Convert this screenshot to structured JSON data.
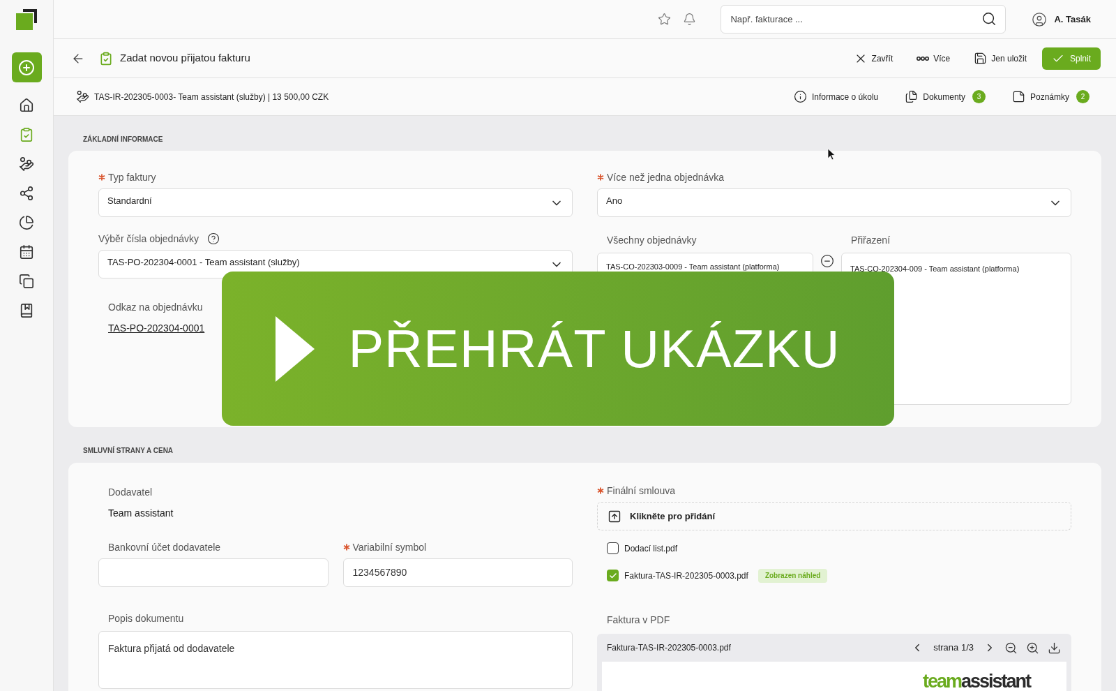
{
  "sidebar": {
    "items": [
      {
        "kind": "add",
        "selected": true
      },
      {
        "kind": "home",
        "selected": false
      },
      {
        "kind": "tasks",
        "selected": true
      },
      {
        "kind": "invoices",
        "selected": false
      },
      {
        "kind": "workflow",
        "selected": false
      },
      {
        "kind": "time",
        "selected": false
      },
      {
        "kind": "calendar",
        "selected": false
      },
      {
        "kind": "documents",
        "selected": false
      },
      {
        "kind": "book",
        "selected": false
      }
    ]
  },
  "topbar": {
    "search": {
      "placeholder": "Např. fakturace ..."
    },
    "user": "A. Tasák"
  },
  "page_header": {
    "title": "Zadat novou přijatou fakturu",
    "actions": [
      {
        "kind": "close",
        "label": "Zavřít"
      },
      {
        "kind": "more",
        "label": "Více"
      },
      {
        "kind": "save",
        "label": "Jen uložit"
      },
      {
        "kind": "primary",
        "label": "Splnit"
      }
    ]
  },
  "subheader": {
    "record": "TAS-IR-202305-0003- Team assistant (služby) | 13 500,00 CZK",
    "tabs": [
      {
        "kind": "info",
        "label": "Informace o úkolu"
      },
      {
        "kind": "documents",
        "label": "Dokumenty",
        "count": "3"
      },
      {
        "kind": "notes",
        "label": "Poznámky",
        "count": "2"
      }
    ]
  },
  "basic_info": {
    "heading": "ZÁKLADNÍ INFORMACE",
    "invoice_type": {
      "label": "Typ faktury",
      "required": true,
      "value": "Standardní"
    },
    "multiple_orders": {
      "label": "Více než jedna objednávka",
      "required": true,
      "value": "Ano"
    },
    "order_number": {
      "label": "Výběr čísla objednávky",
      "value": "TAS-PO-202304-0001 - Team assistant (služby)"
    },
    "order_link": {
      "label": "Odkaz na objednávku",
      "value": "TAS-PO-202304-0001"
    },
    "all_orders": {
      "label": "Všechny objednávky",
      "value": "TAS-CO-202303-0009 - Team assistant (platforma)"
    },
    "assignment": {
      "label": "Přiřazení",
      "value": "TAS-CO-202304-009 - Team assistant (platforma)"
    }
  },
  "video_overlay": {
    "label": "PŘEHRÁT UKÁZKU"
  },
  "parties": {
    "heading": "SMLUVNÍ STRANY A CENA",
    "supplier": {
      "label": "Dodavatel",
      "value": "Team assistant"
    },
    "bank_account": {
      "label": "Bankovní účet dodavatele"
    },
    "variable_symbol": {
      "label": "Variabilní symbol",
      "required": true,
      "value": "1234567890"
    },
    "description": {
      "label": "Popis dokumentu",
      "value": "Faktura přijatá od dodavatele"
    },
    "final_contract": {
      "label": "Finální smlouva",
      "required": true,
      "upload": "Klikněte pro přidání",
      "files": [
        {
          "name": "Dodací list.pdf",
          "checked": false
        },
        {
          "name": "Faktura-TAS-IR-202305-0003.pdf",
          "checked": true,
          "badge": "Zobrazen náhled"
        }
      ]
    },
    "pdf": {
      "label": "Faktura v PDF",
      "file": "Faktura-TAS-IR-202305-0003.pdf",
      "page": "strana 1/3",
      "logo": [
        {
          "text": "team",
          "color": "#6aab1e"
        },
        {
          "text": "assistant",
          "color": "#2b2b2b"
        }
      ]
    }
  }
}
